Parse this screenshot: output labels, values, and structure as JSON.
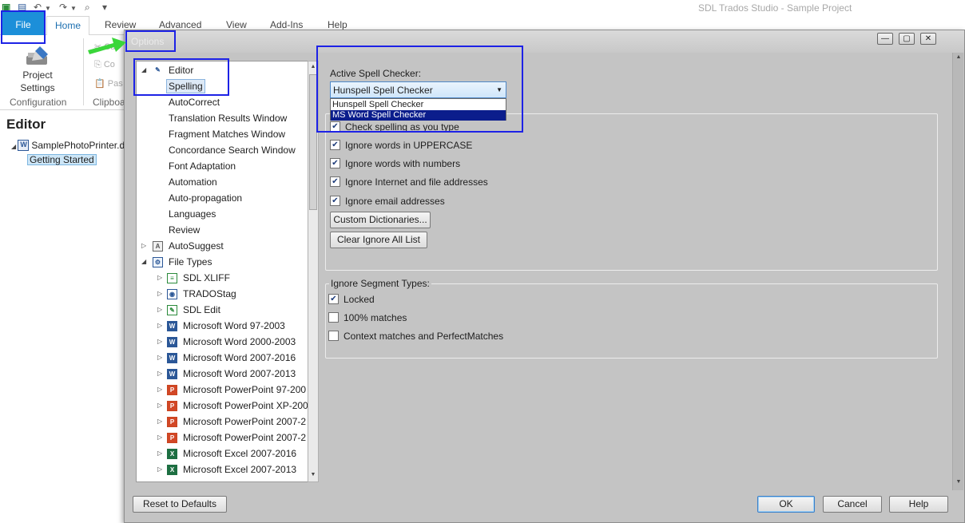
{
  "app": {
    "title": "SDL Trados Studio - Sample Project",
    "qat_icons": [
      "studio-logo-icon",
      "save-icon",
      "undo-icon",
      "redo-icon",
      "print-preview-icon",
      "customize-qat-icon"
    ],
    "ribbon_tabs": [
      "File",
      "Home",
      "Review",
      "Advanced",
      "View",
      "Add-Ins",
      "Help"
    ],
    "ribbon": {
      "project_settings_label": "Project\nSettings",
      "configuration_group": "Configuration",
      "clipboard_group": "Clipboa",
      "cut_label": "Cut",
      "copy_label": "Co",
      "paste_label": "Pas"
    },
    "editor_pane": {
      "heading": "Editor",
      "file_node": "SamplePhotoPrinter.d",
      "child_node": "Getting Started"
    }
  },
  "dialog": {
    "title": "Options",
    "tree": [
      {
        "label": "Editor",
        "level": 0,
        "expanded": true,
        "icon": "pencil-icon"
      },
      {
        "label": "Spelling",
        "level": 1,
        "selected": true
      },
      {
        "label": "AutoCorrect",
        "level": 1
      },
      {
        "label": "Translation Results Window",
        "level": 1
      },
      {
        "label": "Fragment Matches Window",
        "level": 1
      },
      {
        "label": "Concordance Search Window",
        "level": 1
      },
      {
        "label": "Font Adaptation",
        "level": 1
      },
      {
        "label": "Automation",
        "level": 1
      },
      {
        "label": "Auto-propagation",
        "level": 1
      },
      {
        "label": "Languages",
        "level": 1
      },
      {
        "label": "Review",
        "level": 1
      },
      {
        "label": "AutoSuggest",
        "level": 0,
        "expanded": false,
        "icon": "autosuggest-icon"
      },
      {
        "label": "File Types",
        "level": 0,
        "expanded": true,
        "icon": "gear-file-icon"
      },
      {
        "label": "SDL XLIFF",
        "level": 1,
        "icon": "sdlxliff-icon"
      },
      {
        "label": "TRADOStag",
        "level": 1,
        "icon": "tradostag-icon"
      },
      {
        "label": "SDL Edit",
        "level": 1,
        "icon": "sdl-edit-icon"
      },
      {
        "label": "Microsoft Word 97-2003",
        "level": 1,
        "icon": "word-icon"
      },
      {
        "label": "Microsoft Word 2000-2003",
        "level": 1,
        "icon": "word-icon"
      },
      {
        "label": "Microsoft Word 2007-2016",
        "level": 1,
        "icon": "word-icon"
      },
      {
        "label": "Microsoft Word 2007-2013",
        "level": 1,
        "icon": "word-icon"
      },
      {
        "label": "Microsoft PowerPoint 97-200",
        "level": 1,
        "icon": "powerpoint-icon"
      },
      {
        "label": "Microsoft PowerPoint XP-200",
        "level": 1,
        "icon": "powerpoint-icon"
      },
      {
        "label": "Microsoft PowerPoint 2007-2",
        "level": 1,
        "icon": "powerpoint-icon"
      },
      {
        "label": "Microsoft PowerPoint 2007-2",
        "level": 1,
        "icon": "powerpoint-icon"
      },
      {
        "label": "Microsoft Excel 2007-2016",
        "level": 1,
        "icon": "excel-icon"
      },
      {
        "label": "Microsoft Excel 2007-2013",
        "level": 1,
        "icon": "excel-icon"
      }
    ],
    "spelling": {
      "active_label": "Active Spell Checker:",
      "selected": "Hunspell Spell Checker",
      "options": [
        "Hunspell Spell Checker",
        "MS Word Spell Checker"
      ],
      "highlighted_option": "MS Word Spell Checker",
      "checks": [
        {
          "label": "Check spelling as you type",
          "checked": true
        },
        {
          "label": "Ignore words in UPPERCASE",
          "checked": true
        },
        {
          "label": "Ignore words with numbers",
          "checked": true
        },
        {
          "label": "Ignore Internet and file addresses",
          "checked": true
        },
        {
          "label": "Ignore email addresses",
          "checked": true
        }
      ],
      "custom_dict_button": "Custom Dictionaries...",
      "clear_ignore_button": "Clear Ignore All List",
      "segment_group_title": "Ignore Segment Types:",
      "segment_checks": [
        {
          "label": "Locked",
          "checked": true
        },
        {
          "label": "100% matches",
          "checked": false
        },
        {
          "label": "Context matches and PerfectMatches",
          "checked": false
        }
      ]
    },
    "buttons": {
      "reset": "Reset to Defaults",
      "ok": "OK",
      "cancel": "Cancel",
      "help": "Help"
    }
  },
  "annotation_colors": {
    "box": "#1d22e6",
    "arrow": "#3ad63a"
  }
}
